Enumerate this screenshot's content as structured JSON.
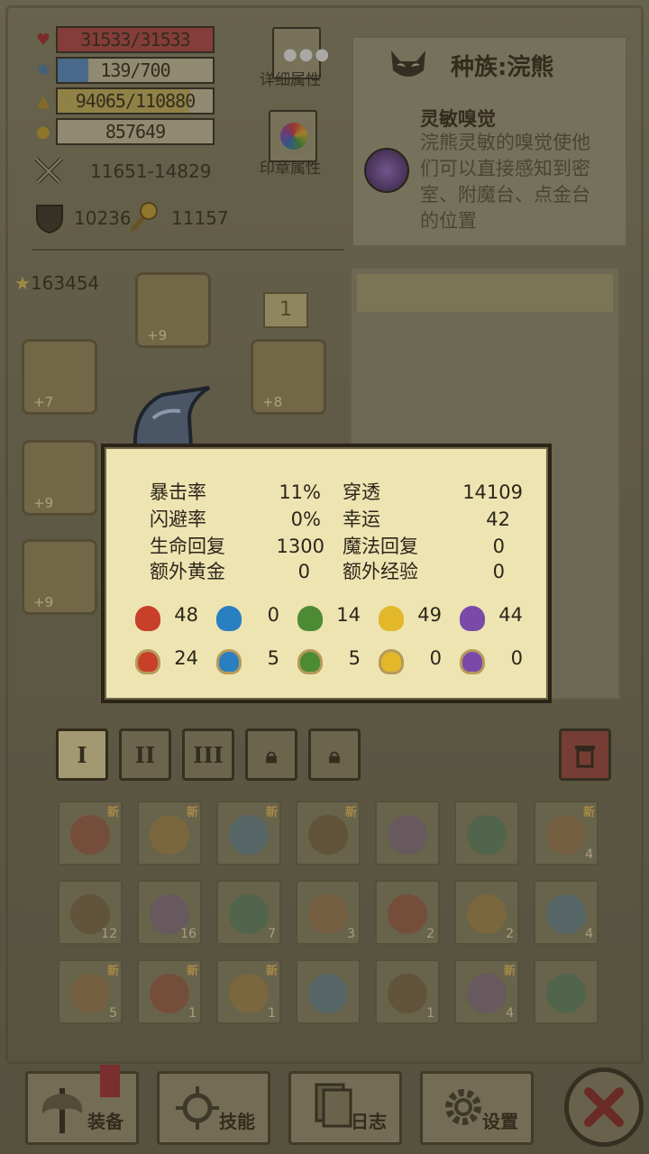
{
  "stats": {
    "hp": "31533/31533",
    "mp": "139/700",
    "exp": "94065/110880",
    "gold": "857649",
    "hp_fraction": 1.0,
    "mp_fraction": 0.1986,
    "exp_fraction": 0.8483,
    "attack": "11651-14829",
    "defense": "10236",
    "magic_power": "11157",
    "score": "163454"
  },
  "buttons": {
    "detail_attributes": "详细属性",
    "seal_attributes": "印章属性"
  },
  "race": {
    "title": "种族:浣熊",
    "skill_name": "灵敏嗅觉",
    "skill_desc": "浣熊灵敏的嗅觉使他们可以直接感知到密室、附魔台、点金台的位置"
  },
  "equipment": {
    "slot_badge": "1",
    "levels": [
      "+9",
      "+7",
      "+8",
      "+9",
      "+9"
    ]
  },
  "popup": {
    "rows": [
      {
        "label": "暴击率",
        "value": "11%",
        "label2": "穿透",
        "value2": "14109"
      },
      {
        "label": "闪避率",
        "value": "0%",
        "label2": "幸运",
        "value2": "42"
      },
      {
        "label": "生命回复",
        "value": "1300",
        "label2": "魔法回复",
        "value2": "0"
      },
      {
        "label": "额外黄金",
        "value": "0",
        "label2": "额外经验",
        "value2": "0"
      }
    ],
    "element_attack": [
      "48",
      "0",
      "14",
      "49",
      "44"
    ],
    "element_resist": [
      "24",
      "5",
      "5",
      "0",
      "0"
    ]
  },
  "colors": {
    "fire": "#c8402a",
    "water": "#2a7fc0",
    "earth": "#4d8a34",
    "light": "#e2b82a",
    "dark": "#7a4aa8"
  },
  "bag_tabs": [
    "I",
    "II",
    "III"
  ],
  "inventory": {
    "new_label": "新",
    "counts": [
      [
        "",
        "",
        "",
        "",
        "",
        "",
        "4"
      ],
      [
        "12",
        "16",
        "7",
        "3",
        "2",
        "2",
        "4"
      ],
      [
        "5",
        "1",
        "1",
        "",
        "1",
        "4",
        ""
      ]
    ]
  },
  "nav": {
    "equip": "装备",
    "skills": "技能",
    "log": "日志",
    "settings": "设置"
  }
}
